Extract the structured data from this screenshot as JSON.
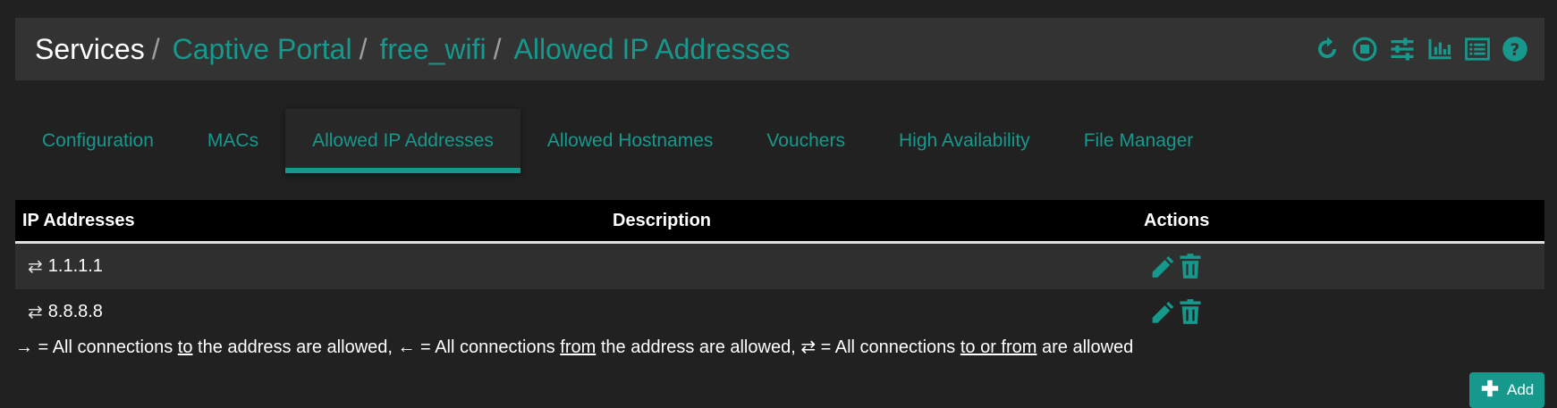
{
  "breadcrumb": {
    "home": "Services",
    "items": [
      "Captive Portal",
      "free_wifi",
      "Allowed IP Addresses"
    ],
    "separator": "/"
  },
  "header_icons": [
    "reload-icon",
    "stop-circle-icon",
    "sliders-icon",
    "bar-chart-icon",
    "list-icon",
    "help-icon"
  ],
  "tabs": [
    {
      "label": "Configuration",
      "active": false
    },
    {
      "label": "MACs",
      "active": false
    },
    {
      "label": "Allowed IP Addresses",
      "active": true
    },
    {
      "label": "Allowed Hostnames",
      "active": false
    },
    {
      "label": "Vouchers",
      "active": false
    },
    {
      "label": "High Availability",
      "active": false
    },
    {
      "label": "File Manager",
      "active": false
    }
  ],
  "table": {
    "headers": {
      "ip": "IP Addresses",
      "description": "Description",
      "actions": "Actions"
    },
    "rows": [
      {
        "direction": "⇄",
        "ip": "1.1.1.1",
        "description": ""
      },
      {
        "direction": "⇄",
        "ip": "8.8.8.8",
        "description": ""
      }
    ]
  },
  "legend": {
    "to_arrow": "→",
    "to_text_a": " = All connections ",
    "to_word": "to",
    "to_text_b": " the address are allowed, ",
    "from_arrow": "←",
    "from_text_a": " = All connections ",
    "from_word": "from",
    "from_text_b": " the address are allowed, ",
    "both_arrow": "⇄",
    "both_text_a": " = All connections ",
    "both_word": "to or from",
    "both_text_b": " are allowed"
  },
  "add_button": {
    "label": "Add"
  },
  "colors": {
    "accent": "#16998c",
    "background": "#212121",
    "header": "#333333",
    "table_head": "#000000"
  }
}
